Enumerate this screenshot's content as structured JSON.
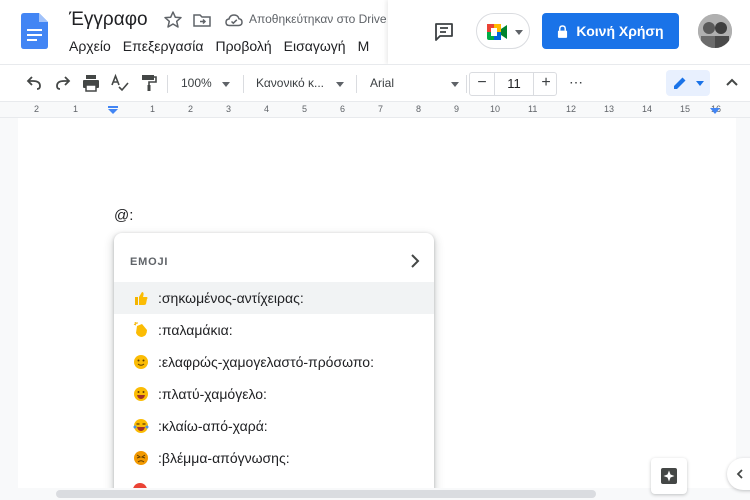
{
  "header": {
    "title": "Έγγραφο",
    "save_status": "Αποθηκεύτηκαν στο Drive",
    "menus": [
      "Αρχείο",
      "Επεξεργασία",
      "Προβολή",
      "Εισαγωγή",
      "Μ"
    ],
    "share_label": "Κοινή Χρήση",
    "accent": "#1a73e8"
  },
  "toolbar": {
    "zoom": "100%",
    "style": "Κανονικό κ...",
    "font": "Arial",
    "font_size": "11",
    "minus": "−",
    "plus": "+",
    "more": "⋯"
  },
  "ruler": {
    "marks": [
      "2",
      "1",
      "1",
      "2",
      "3",
      "4",
      "5",
      "6",
      "7",
      "8",
      "9",
      "10",
      "11",
      "12",
      "13",
      "14",
      "15",
      "16"
    ]
  },
  "document": {
    "typed": "@:"
  },
  "popup": {
    "heading": "EMOJI",
    "items": [
      {
        "icon": "thumbs-up-icon",
        "glyph": "👍",
        "label": ":σηκωμένος-αντίχειρας:"
      },
      {
        "icon": "clapping-hands-icon",
        "glyph": "👏",
        "label": ":παλαμάκια:"
      },
      {
        "icon": "slightly-smiling-face-icon",
        "glyph": "🙂",
        "label": ":ελαφρώς-χαμογελαστό-πρόσωπο:"
      },
      {
        "icon": "grinning-face-icon",
        "glyph": "😃",
        "label": ":πλατύ-χαμόγελο:"
      },
      {
        "icon": "tears-of-joy-icon",
        "glyph": "😂",
        "label": ":κλαίω-από-χαρά:"
      },
      {
        "icon": "despair-face-icon",
        "glyph": "😣",
        "label": ":βλέμμα-απόγνωσης:"
      }
    ]
  }
}
